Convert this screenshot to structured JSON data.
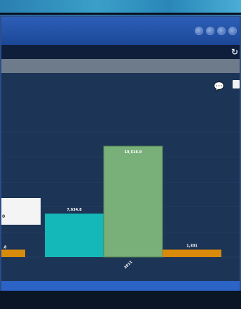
{
  "colors": {
    "window_title": "#2d5fb8",
    "chart_bg": "#1c3455",
    "filter_bar": "#6e7b8a",
    "footer": "#2c63c6"
  },
  "icons": [
    "refresh-icon",
    "comment-icon",
    "printer-icon"
  ],
  "chart_data": {
    "type": "bar",
    "categories": [
      "2011"
    ],
    "series": [
      {
        "name": "",
        "color": "#15b8b8",
        "values": [
          7634.8
        ]
      },
      {
        "name": "",
        "color": "#79b07a",
        "values": [
          19516.9
        ]
      },
      {
        "name": "",
        "color": "#d88a0a",
        "values": [
          1301
        ]
      }
    ],
    "value_labels": [
      "7,634.8",
      "19,516.9",
      "1,301"
    ],
    "partial_left_label": ".8",
    "tooltip_text": "0",
    "ylim": [
      0,
      22000
    ],
    "grid": true
  }
}
